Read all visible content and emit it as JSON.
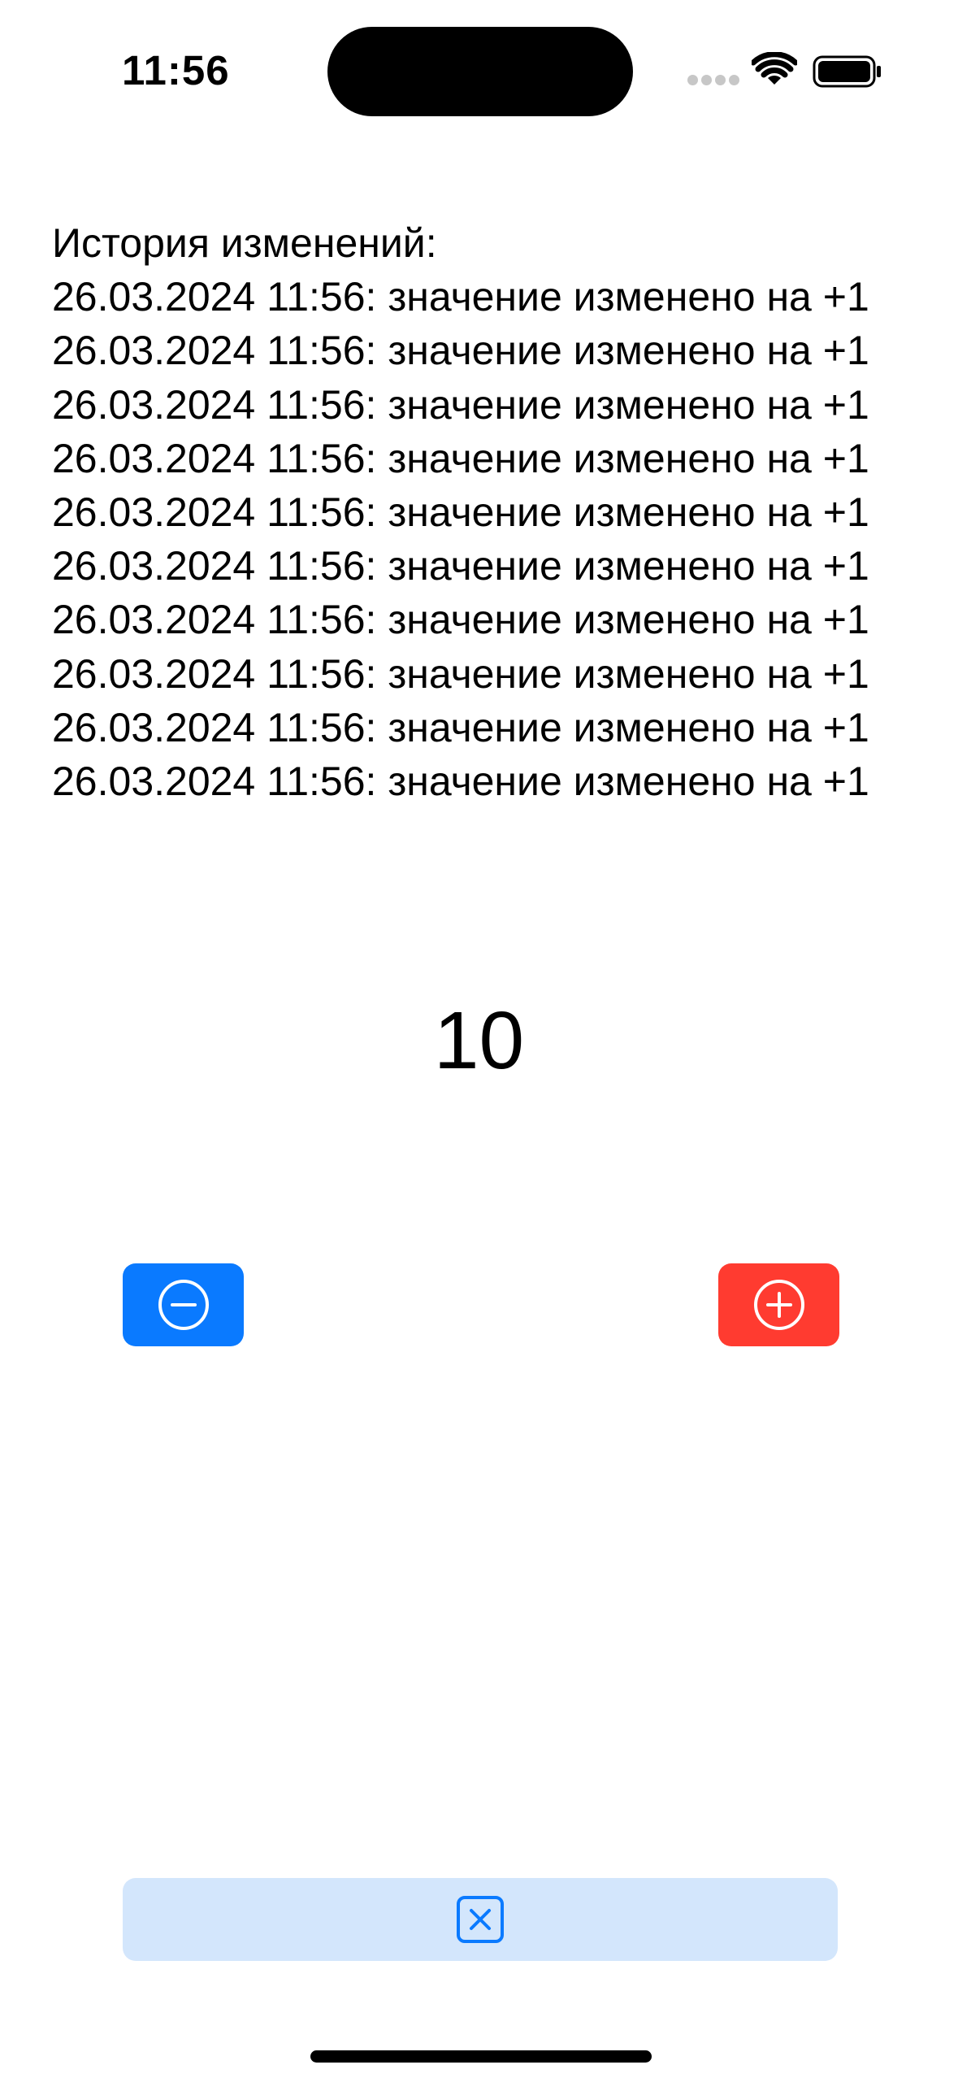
{
  "status_bar": {
    "time": "11:56"
  },
  "history": {
    "title": "История изменений:",
    "entries": [
      "26.03.2024 11:56: значение изменено на +1",
      "26.03.2024 11:56: значение изменено на +1",
      "26.03.2024 11:56: значение изменено на +1",
      "26.03.2024 11:56: значение изменено на +1",
      "26.03.2024 11:56: значение изменено на +1",
      "26.03.2024 11:56: значение изменено на +1",
      "26.03.2024 11:56: значение изменено на +1",
      "26.03.2024 11:56: значение изменено на +1",
      "26.03.2024 11:56: значение изменено на +1",
      "26.03.2024 11:56: значение изменено на +1"
    ]
  },
  "counter": {
    "value": "10"
  },
  "buttons": {
    "decrement": {
      "icon": "minus-circle-icon",
      "color": "#0a7aff"
    },
    "increment": {
      "icon": "plus-circle-icon",
      "color": "#ff3b30"
    },
    "clear": {
      "icon": "xmark-square-icon",
      "color": "#d3e6fc",
      "icon_color": "#0a7aff"
    }
  }
}
